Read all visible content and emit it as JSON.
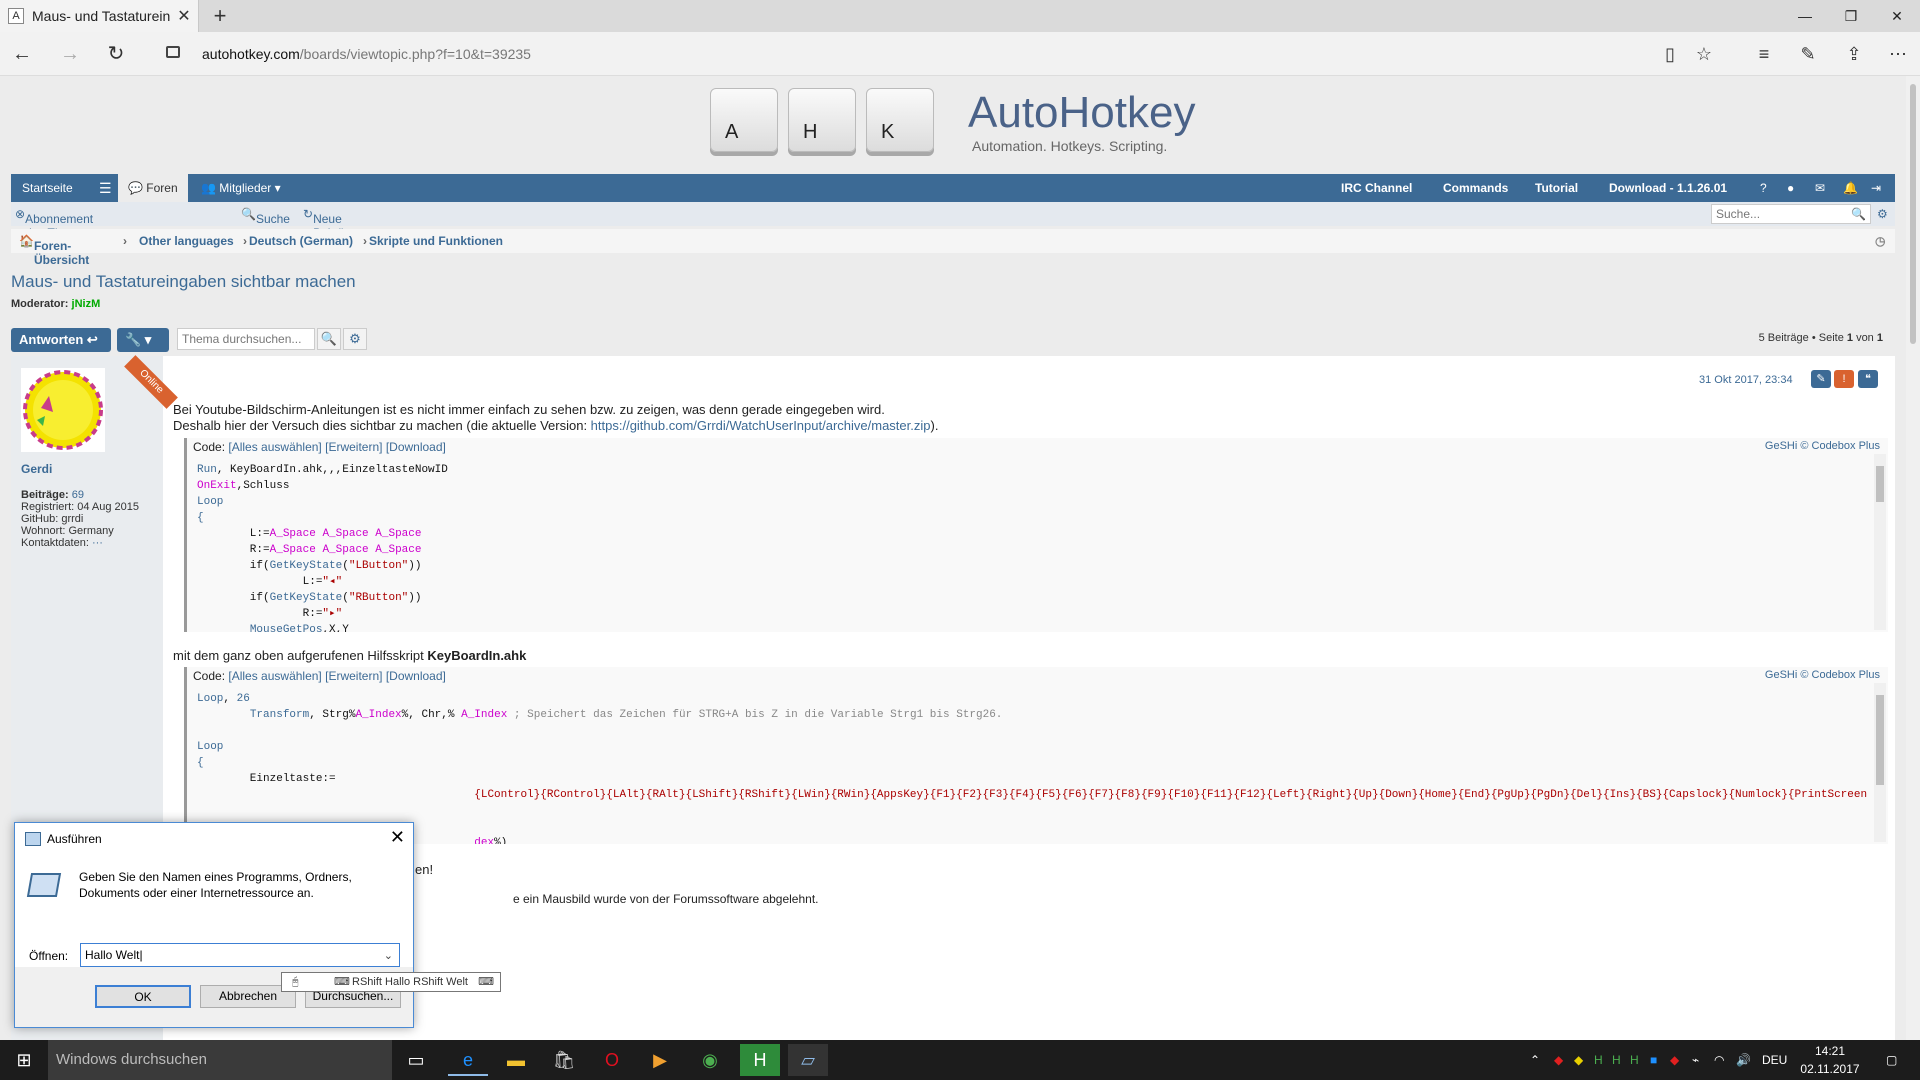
{
  "browser": {
    "tab_title": "Maus- und Tastatureing",
    "tab_favicon": "A",
    "url_domain": "autohotkey.com",
    "url_path": "/boards/viewtopic.php?f=10&t=39235"
  },
  "site": {
    "keys": [
      "A",
      "H",
      "K"
    ],
    "brand": "AutoHotkey",
    "tagline": "Automation. Hotkeys. Scripting."
  },
  "navbar": {
    "home": "Startseite",
    "forums": "Foren",
    "members": "Mitglieder",
    "irc": "IRC Channel",
    "commands": "Commands",
    "tutorial": "Tutorial",
    "download": "Download - 1.1.26.01"
  },
  "subnav": {
    "unsubscribe": "Abonnement des Themas beenden",
    "search": "Suche",
    "new_posts": "Neue Beiträge",
    "search_placeholder": "Suche..."
  },
  "breadcrumb": [
    "Foren-Übersicht",
    "Other languages",
    "Deutsch (German)",
    "Skripte und Funktionen"
  ],
  "topic": {
    "title": "Maus- und Tastatureingaben sichtbar machen",
    "moderator_label": "Moderator:",
    "moderator_name": "jNizM"
  },
  "actions": {
    "reply": "Antworten",
    "search_placeholder": "Thema durchsuchen...",
    "pagination_count": "5 Beiträge",
    "pagination_sep": "• Seite",
    "pagination_page": "1",
    "pagination_of": "von",
    "pagination_total": "1"
  },
  "post": {
    "online_badge": "Online",
    "username": "Gerdi",
    "posts_label": "Beiträge:",
    "posts_value": "69",
    "registered": "Registriert: 04 Aug 2015",
    "github": "GitHub: grrdi",
    "location": "Wohnort: Germany",
    "contact": "Kontaktdaten:",
    "contact_dots": "···",
    "date": "31 Okt 2017, 23:34",
    "line1": "Bei Youtube-Bildschirm-Anleitungen ist es nicht immer einfach zu sehen bzw. zu zeigen, was denn gerade eingegeben wird.",
    "line2_pre": "Deshalb hier der Versuch dies sichtbar zu machen (die aktuelle Version: ",
    "line2_link": "https://github.com/Grrdi/WatchUserInput/archive/master.zip",
    "line2_post": ").",
    "between_pre": "mit dem ganz oben aufgerufenen Hilfsskript ",
    "between_bold": "KeyBoardIn.ahk",
    "under_code2": "en!",
    "bottom_line": "e ein Mausbild wurde von der Forumssoftware abgelehnt."
  },
  "code": {
    "label": "Code:",
    "select_all": "[Alles auswählen]",
    "expand": "[Erweitern]",
    "download": "[Download]",
    "geshi": "GeSHi © Codebox Plus"
  },
  "run_dialog": {
    "title": "Ausführen",
    "description": "Geben Sie den Namen eines Programms, Ordners, Dokuments oder einer Internetressource an.",
    "open_label": "Öffnen:",
    "input_value": "Hallo Welt",
    "ok": "OK",
    "cancel": "Abbrechen",
    "browse": "Durchsuchen..."
  },
  "tooltip": {
    "text": "RShift Hallo  RShift Welt"
  },
  "taskbar": {
    "search_placeholder": "Windows durchsuchen",
    "lang": "DEU",
    "time": "14:21",
    "date": "02.11.2017"
  },
  "colors": {
    "forum_blue": "#3c6a95",
    "orange": "#d9622f",
    "moderator_green": "#00aa00"
  }
}
